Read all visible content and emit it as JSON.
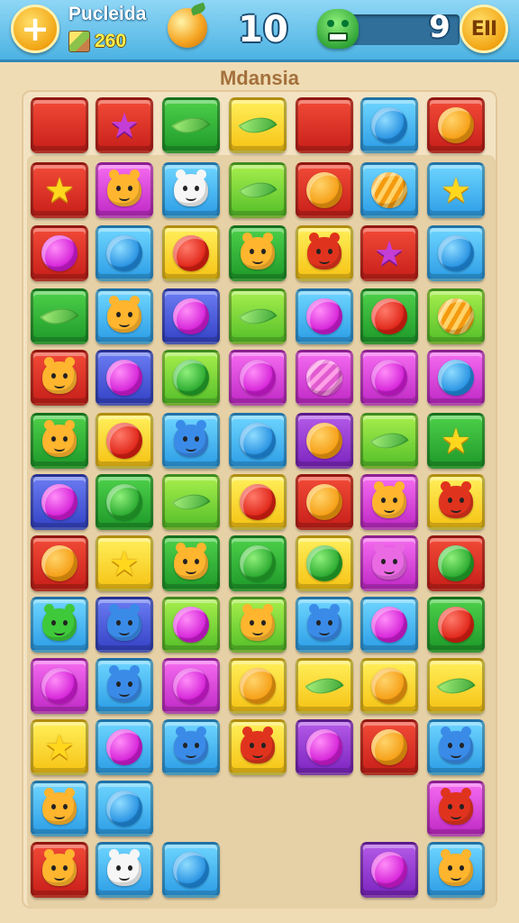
{
  "header": {
    "add_label": "+",
    "player_name": "Pucleida",
    "coins": "260",
    "moves": "10",
    "target_count": "9",
    "pause_label": "EII",
    "target_progress": 0.0
  },
  "level_title": "Mdansia",
  "board": {
    "tiles": [
      [
        {
          "c": "red",
          "p": "blank"
        },
        {
          "c": "red",
          "p": "purple-star"
        },
        {
          "c": "green",
          "p": "leaf"
        },
        {
          "c": "yellow",
          "p": "leaf"
        },
        {
          "c": "red",
          "p": "blank"
        },
        {
          "c": "blue",
          "p": "gem-blue"
        },
        {
          "c": "red",
          "p": "gem-orange"
        }
      ],
      [
        {
          "c": "red",
          "p": "star"
        },
        {
          "c": "magenta",
          "p": "face-orange"
        },
        {
          "c": "blue",
          "p": "face-white"
        },
        {
          "c": "lime",
          "p": "leaf"
        },
        {
          "c": "red",
          "p": "gem-orange"
        },
        {
          "c": "blue",
          "p": "gem-orange-striped"
        },
        {
          "c": "blue",
          "p": "star"
        }
      ],
      [
        {
          "c": "red",
          "p": "gem-magenta"
        },
        {
          "c": "blue",
          "p": "gem-blue"
        },
        {
          "c": "yellow",
          "p": "gem-red"
        },
        {
          "c": "green",
          "p": "face-orange"
        },
        {
          "c": "yellow",
          "p": "face-red"
        },
        {
          "c": "red",
          "p": "purple-star"
        },
        {
          "c": "blue",
          "p": "gem-blue"
        }
      ],
      [
        {
          "c": "green",
          "p": "leaf"
        },
        {
          "c": "blue",
          "p": "face-orange"
        },
        {
          "c": "royal",
          "p": "gem-magenta"
        },
        {
          "c": "lime",
          "p": "leaf"
        },
        {
          "c": "blue",
          "p": "gem-magenta"
        },
        {
          "c": "green",
          "p": "gem-red"
        },
        {
          "c": "lime",
          "p": "gem-orange-striped"
        }
      ],
      [
        {
          "c": "red",
          "p": "face-orange"
        },
        {
          "c": "royal",
          "p": "gem-magenta"
        },
        {
          "c": "lime",
          "p": "gem-green"
        },
        {
          "c": "magenta",
          "p": "gem-magenta"
        },
        {
          "c": "magenta",
          "p": "gem-pink"
        },
        {
          "c": "magenta",
          "p": "gem-magenta"
        },
        {
          "c": "magenta",
          "p": "gem-blue"
        }
      ],
      [
        {
          "c": "green",
          "p": "face-orange"
        },
        {
          "c": "yellow",
          "p": "gem-red"
        },
        {
          "c": "blue",
          "p": "face-blue"
        },
        {
          "c": "blue",
          "p": "gem-blue"
        },
        {
          "c": "purple",
          "p": "gem-orange"
        },
        {
          "c": "lime",
          "p": "leaf"
        },
        {
          "c": "green",
          "p": "star"
        }
      ],
      [
        {
          "c": "royal",
          "p": "gem-magenta"
        },
        {
          "c": "green",
          "p": "gem-green"
        },
        {
          "c": "lime",
          "p": "leaf"
        },
        {
          "c": "yellow",
          "p": "gem-red"
        },
        {
          "c": "red",
          "p": "gem-orange"
        },
        {
          "c": "magenta",
          "p": "face-orange"
        },
        {
          "c": "yellow",
          "p": "face-red"
        }
      ],
      [
        {
          "c": "red",
          "p": "gem-orange"
        },
        {
          "c": "yellow",
          "p": "star"
        },
        {
          "c": "green",
          "p": "face-orange"
        },
        {
          "c": "green",
          "p": "gem-green"
        },
        {
          "c": "yellow",
          "p": "gem-green"
        },
        {
          "c": "magenta",
          "p": "face-pink"
        },
        {
          "c": "red",
          "p": "gem-green"
        }
      ],
      [
        {
          "c": "blue",
          "p": "face-green"
        },
        {
          "c": "royal",
          "p": "face-blue"
        },
        {
          "c": "lime",
          "p": "gem-magenta"
        },
        {
          "c": "lime",
          "p": "face-orange"
        },
        {
          "c": "blue",
          "p": "face-blue"
        },
        {
          "c": "blue",
          "p": "gem-magenta"
        },
        {
          "c": "green",
          "p": "gem-red"
        }
      ],
      [
        {
          "c": "magenta",
          "p": "gem-magenta"
        },
        {
          "c": "blue",
          "p": "face-blue"
        },
        {
          "c": "magenta",
          "p": "gem-magenta"
        },
        {
          "c": "yellow",
          "p": "gem-orange"
        },
        {
          "c": "yellow",
          "p": "leaf"
        },
        {
          "c": "yellow",
          "p": "gem-orange"
        },
        {
          "c": "yellow",
          "p": "leaf"
        }
      ],
      [
        {
          "c": "yellow",
          "p": "star"
        },
        {
          "c": "blue",
          "p": "gem-magenta"
        },
        {
          "c": "blue",
          "p": "face-blue"
        },
        {
          "c": "yellow",
          "p": "face-red"
        },
        {
          "c": "purple",
          "p": "gem-magenta"
        },
        {
          "c": "red",
          "p": "gem-orange"
        },
        {
          "c": "blue",
          "p": "face-blue"
        }
      ],
      [
        {
          "c": "blue",
          "p": "face-orange"
        },
        {
          "c": "blue",
          "p": "gem-blue"
        },
        null,
        null,
        null,
        null,
        {
          "c": "magenta",
          "p": "face-red"
        }
      ],
      [
        {
          "c": "red",
          "p": "face-orange"
        },
        {
          "c": "blue",
          "p": "face-white"
        },
        {
          "c": "blue",
          "p": "gem-blue"
        },
        null,
        null,
        {
          "c": "purple",
          "p": "gem-magenta"
        },
        {
          "c": "blue",
          "p": "face-orange"
        }
      ]
    ]
  }
}
